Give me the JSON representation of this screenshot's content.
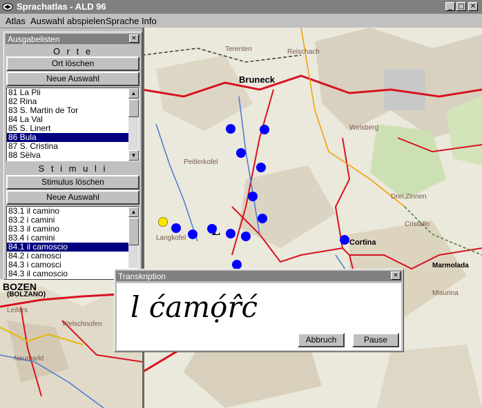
{
  "window": {
    "title": "Sprachatlas - ALD 96",
    "minimize": "_",
    "maximize": "□",
    "close": "✕"
  },
  "menu": [
    "Atlas",
    "Auswahl",
    "abspielen",
    "Sprache",
    "Info"
  ],
  "panel": {
    "title": "Ausgabelisten",
    "orte": {
      "heading": "O r t e",
      "delete_label": "Ort löschen",
      "new_label": "Neue Auswahl",
      "items": [
        "81 La Pli",
        "82 Rina",
        "83 S. Martin de Tor",
        "84 La Val",
        "85 S. Linert",
        "86 Bula",
        "87 S. Cristina",
        "88 Sëlva"
      ],
      "selected_index": 5
    },
    "stimuli": {
      "heading": "S t i m u l i",
      "delete_label": "Stimulus löschen",
      "new_label": "Neue Auswahl",
      "items": [
        "83.1 il camino",
        "83.2 i camini",
        "83.3 il camino",
        "83.4 i camini",
        "84.1 il camoscio",
        "84.2 i camosci",
        "84.3 i camosci",
        "84.3 il camoscio"
      ],
      "selected_index": 4
    }
  },
  "dialog": {
    "title": "Transkription",
    "text": "l ćamọ́r̂ć",
    "abbruch_label": "Abbruch",
    "pause_label": "Pause"
  },
  "map": {
    "labels": {
      "bruneck": "Bruneck",
      "cortina": "Cortina",
      "bozen": "BOZEN",
      "bolzano": "(BOLZANO)",
      "l": "L",
      "marmolada": "Marmolada"
    },
    "point_color_blue": "#0000ff",
    "point_color_yellow": "#ffe800"
  }
}
